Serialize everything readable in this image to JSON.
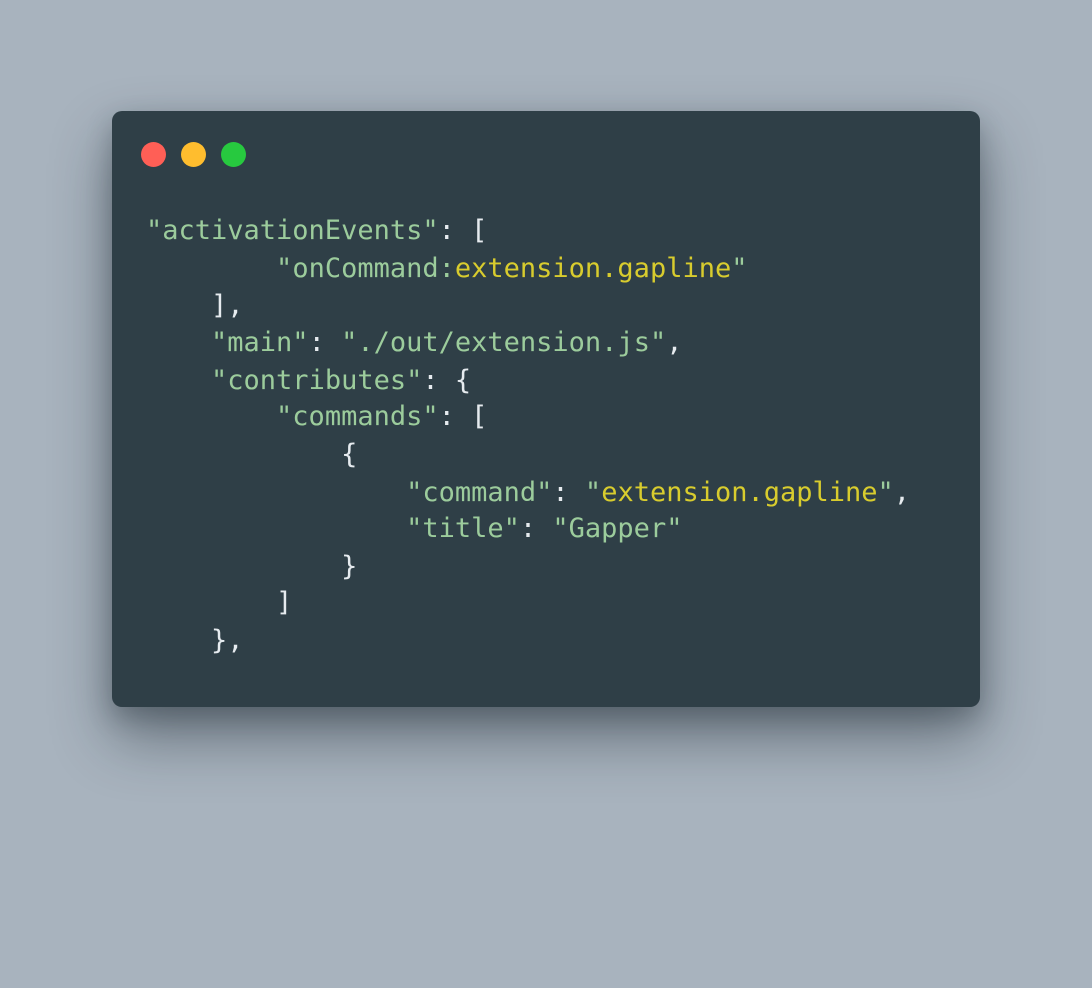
{
  "window": {
    "dots": [
      "close",
      "minimize",
      "maximize"
    ]
  },
  "code": {
    "l1": {
      "key": "\"activationEvents\"",
      "punct": ": ["
    },
    "l2": {
      "q1": "\"",
      "prefix": "onCommand:",
      "value": "extension.gapline",
      "q2": "\""
    },
    "l3": {
      "punct": "],"
    },
    "l4": {
      "key": "\"main\"",
      "sep": ": ",
      "value": "\"./out/extension.js\"",
      "punct": ","
    },
    "l5": {
      "key": "\"contributes\"",
      "punct": ": {"
    },
    "l6": {
      "key": "\"commands\"",
      "punct": ": ["
    },
    "l7": {
      "punct": "{"
    },
    "l8": {
      "key": "\"command\"",
      "sep": ": ",
      "q1": "\"",
      "value": "extension.gapline",
      "q2": "\"",
      "punct": ","
    },
    "l9": {
      "key": "\"title\"",
      "sep": ": ",
      "value": "\"Gapper\""
    },
    "l10": {
      "punct": "}"
    },
    "l11": {
      "punct": "]"
    },
    "l12": {
      "punct": "},"
    }
  },
  "colors": {
    "background": "#a8b3be",
    "window": "#2f3f47",
    "string": "#9ccc9c",
    "highlight": "#d8cc2e",
    "punctuation": "#e6ebef"
  }
}
